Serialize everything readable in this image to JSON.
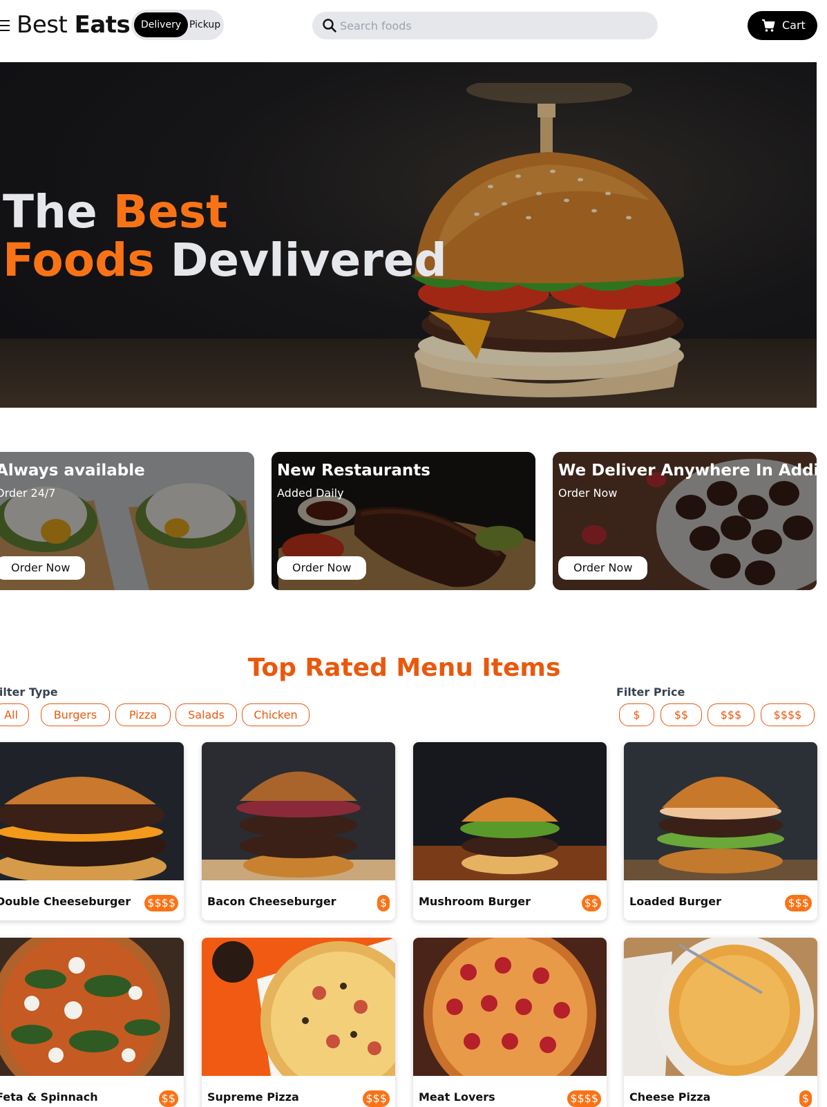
{
  "header": {
    "logo_light": "Best",
    "logo_bold": "Eats",
    "mode_delivery": "Delivery",
    "mode_pickup": "Pickup",
    "search_placeholder": "Search foods",
    "cart_label": "Cart"
  },
  "hero": {
    "line1_white": "The ",
    "line1_accent": "Best",
    "line2_accent": "Foods",
    "line2_white": " Devlivered"
  },
  "promos": [
    {
      "title": "Always available",
      "subtitle": "Order 24/7",
      "button": "Order Now"
    },
    {
      "title": "New Restaurants",
      "subtitle": "Added Daily",
      "button": "Order Now"
    },
    {
      "title": "We Deliver Anywhere In Addis",
      "subtitle": "Order Now",
      "button": "Order Now"
    }
  ],
  "menu": {
    "title": "Top Rated Menu Items",
    "filter_type_label": "Filter Type",
    "filter_price_label": "Filter Price",
    "type_filters": [
      "All",
      "Burgers",
      "Pizza",
      "Salads",
      "Chicken"
    ],
    "price_filters": [
      "$",
      "$$",
      "$$$",
      "$$$$"
    ],
    "items": [
      {
        "name": "Double Cheeseburger",
        "price": "$$$$"
      },
      {
        "name": "Bacon Cheeseburger",
        "price": "$"
      },
      {
        "name": "Mushroom Burger",
        "price": "$$"
      },
      {
        "name": "Loaded Burger",
        "price": "$$$"
      },
      {
        "name": "Feta & Spinnach",
        "price": "$$"
      },
      {
        "name": "Supreme Pizza",
        "price": "$$$"
      },
      {
        "name": "Meat Lovers",
        "price": "$$$$"
      },
      {
        "name": "Cheese Pizza",
        "price": "$"
      }
    ]
  },
  "colors": {
    "accent": "#f97316",
    "accent_dark": "#ea580c",
    "dark": "#000000",
    "chip_bg": "#e5e7eb"
  },
  "icons": {
    "menu": "hamburger-icon",
    "search": "search-icon",
    "cart": "cart-icon"
  }
}
